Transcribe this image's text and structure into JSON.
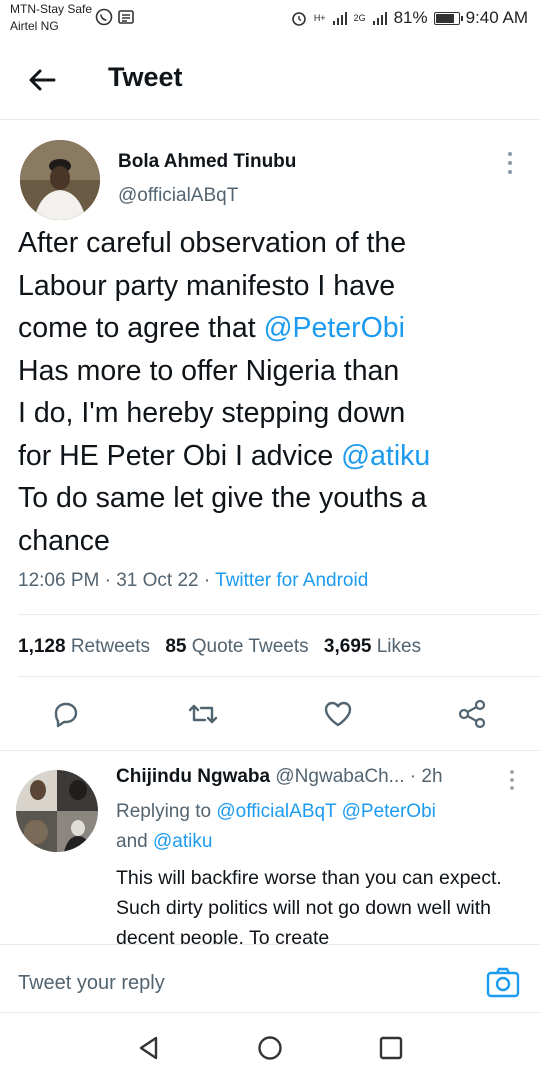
{
  "status_bar": {
    "carrier_1": "MTN-Stay Safe",
    "carrier_2": "Airtel NG",
    "network_1": "H+",
    "network_2": "2G",
    "battery": "81%",
    "battery_level": 0.81,
    "time": "9:40 AM"
  },
  "header": {
    "title": "Tweet"
  },
  "tweet": {
    "author_name": "Bola Ahmed Tinubu",
    "author_handle": "@officialABqT",
    "text_lines": [
      {
        "t": "After careful observation of the"
      },
      {
        "t": "Labour party manifesto I have"
      },
      {
        "pre": "come to agree that ",
        "mention": "@PeterObi"
      },
      {
        "t": "Has more to offer Nigeria than"
      },
      {
        "t": "I do, I'm hereby stepping down"
      },
      {
        "pre": "for HE Peter Obi I advice ",
        "mention": "@atiku"
      },
      {
        "t": "To do same let give the youths a"
      },
      {
        "t": "chance"
      }
    ],
    "time": "12:06 PM",
    "date": "31 Oct 22",
    "source": "Twitter for Android",
    "retweets_count": "1,128",
    "retweets_label": "Retweets",
    "quotes_count": "85",
    "quotes_label": "Quote Tweets",
    "likes_count": "3,695",
    "likes_label": "Likes"
  },
  "reply": {
    "name": "Chijindu Ngwaba",
    "handle": "@NgwabaCh...",
    "time": "2h",
    "replying_prefix": "Replying to",
    "replying_to_1": "@officialABqT",
    "replying_to_2": "@PeterObi",
    "replying_and": "and",
    "replying_to_3": "@atiku",
    "text": "This will backfire worse than you can expect. Such dirty politics will not go down well with decent people. To create"
  },
  "compose": {
    "placeholder": "Tweet your reply"
  },
  "colors": {
    "accent": "#1d9bf0",
    "secondary": "#536471",
    "primary": "#0f1419"
  },
  "icons": [
    "back-arrow-icon",
    "more-vertical-icon",
    "reply-icon",
    "retweet-icon",
    "like-icon",
    "share-icon",
    "camera-icon",
    "nav-back-icon",
    "nav-home-icon",
    "nav-recents-icon"
  ]
}
